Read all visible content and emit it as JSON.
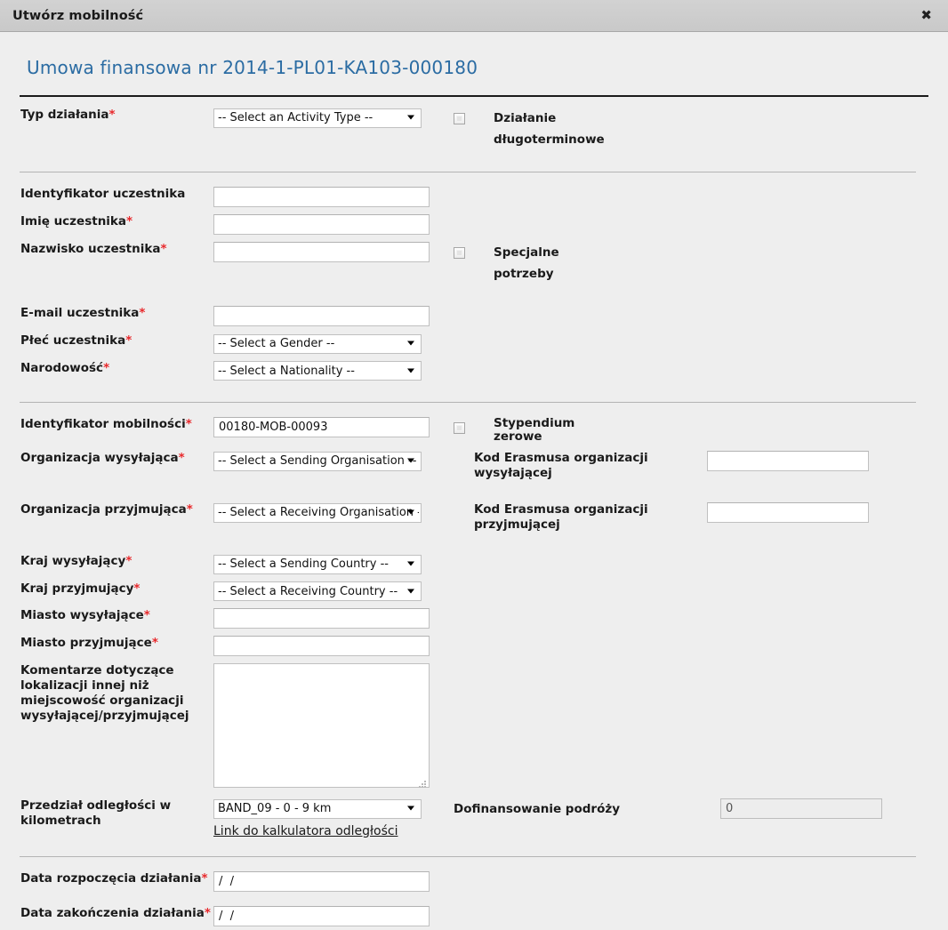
{
  "window": {
    "title": "Utwórz mobilność",
    "close_icon": "close-icon",
    "close_glyph": "✖"
  },
  "page": {
    "agreement_title": "Umowa finansowa nr 2014-1-PL01-KA103-000180"
  },
  "sections": {
    "activity": {
      "activity_type_label": "Typ działania",
      "activity_type_value": "-- Select an Activity Type --",
      "long_term_label": "Działanie długoterminowe",
      "long_term_checked": false
    },
    "participant": {
      "participant_id_label": "Identyfikator uczestnika",
      "participant_id_value": "",
      "first_name_label": "Imię uczestnika",
      "first_name_value": "",
      "last_name_label": "Nazwisko uczestnika",
      "last_name_value": "",
      "email_label": "E-mail uczestnika",
      "email_value": "",
      "gender_label": "Płeć uczestnika",
      "gender_value": "-- Select a Gender --",
      "nationality_label": "Narodowość",
      "nationality_value": "-- Select a Nationality --",
      "special_needs_label": "Specjalne potrzeby",
      "special_needs_checked": false
    },
    "mobility": {
      "mobility_id_label": "Identyfikator mobilności",
      "mobility_id_value": "00180-MOB-00093",
      "sending_org_label": "Organizacja wysyłająca",
      "sending_org_value": "-- Select a Sending Organisation --",
      "receiving_org_label": "Organizacja przyjmująca",
      "receiving_org_value": "-- Select a Receiving Organisation --",
      "sending_country_label": "Kraj wysyłający",
      "sending_country_value": "-- Select a Sending Country --",
      "receiving_country_label": "Kraj przyjmujący",
      "receiving_country_value": "-- Select a Receiving Country --",
      "sending_city_label": "Miasto wysyłające",
      "sending_city_value": "",
      "receiving_city_label": "Miasto przyjmujące",
      "receiving_city_value": "",
      "comments_label": "Komentarze dotyczące lokalizacji innej niż miejscowość organizacji wysyłającej/przyjmującej",
      "comments_value": "",
      "zero_grant_label": "Stypendium zerowe",
      "zero_grant_checked": false,
      "sending_erasmus_code_label": "Kod Erasmusa organizacji wysyłającej",
      "sending_erasmus_code_value": "",
      "receiving_erasmus_code_label": "Kod Erasmusa organizacji przyjmującej",
      "receiving_erasmus_code_value": ""
    },
    "distance": {
      "band_label": "Przedział odległości w kilometrach",
      "band_value": "BAND_09 - 0 - 9 km",
      "calculator_link": "Link do kalkulatora odległości",
      "travel_grant_label": "Dofinansowanie podróży",
      "travel_grant_value": "0"
    },
    "dates": {
      "start_date_label": "Data rozpoczęcia działania",
      "start_date_value": "/  /",
      "end_date_label": "Data zakończenia działania",
      "end_date_value": "/  /"
    }
  },
  "colors": {
    "accent": "#2b6ca3",
    "required": "#e8282b",
    "titlebar": "#cccccc",
    "background": "#eeeeee"
  }
}
